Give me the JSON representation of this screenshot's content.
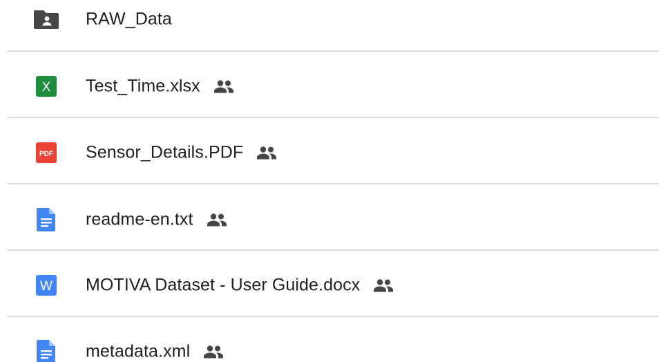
{
  "files": [
    {
      "name": "RAW_Data",
      "type": "shared-folder",
      "icon": "shared-folder-icon",
      "shared": false
    },
    {
      "name": "Test_Time.xlsx",
      "type": "sheet",
      "icon": "excel-icon",
      "icon_label": "X",
      "shared": true
    },
    {
      "name": "Sensor_Details.PDF",
      "type": "pdf",
      "icon": "pdf-icon",
      "icon_label": "PDF",
      "shared": true
    },
    {
      "name": "readme-en.txt",
      "type": "text",
      "icon": "text-document-icon",
      "shared": true
    },
    {
      "name": "MOTIVA Dataset - User Guide.docx",
      "type": "word",
      "icon": "word-icon",
      "icon_label": "W",
      "shared": true
    },
    {
      "name": "metadata.xml",
      "type": "text",
      "icon": "text-document-icon",
      "shared": true
    }
  ],
  "colors": {
    "folder": "#444746",
    "excel": "#1e8e3e",
    "pdf": "#ea4335",
    "doc": "#4285f4",
    "divider": "#dadce0",
    "text": "#1f1f1f",
    "shared_icon": "#444746"
  }
}
